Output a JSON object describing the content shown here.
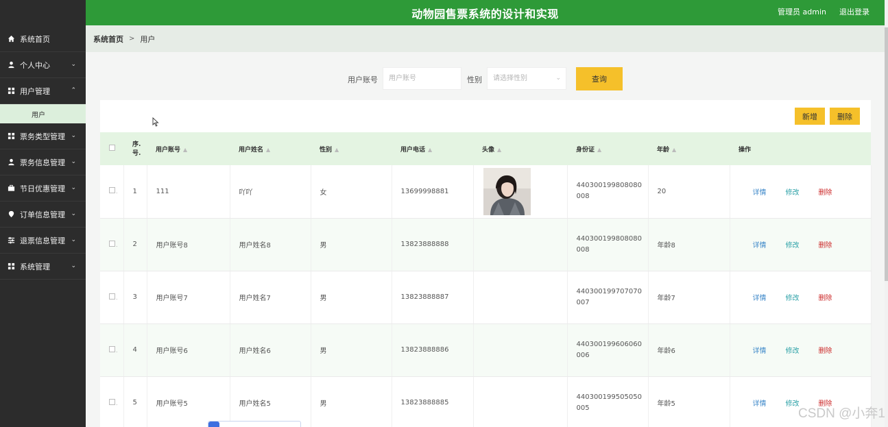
{
  "header": {
    "title": "动物园售票系统的设计和实现",
    "user_text": "管理员 admin",
    "logout_label": "退出登录"
  },
  "sidebar": {
    "items": [
      {
        "label": "系统首页",
        "icon": "home-icon",
        "has_chevron": false
      },
      {
        "label": "个人中心",
        "icon": "person-icon",
        "has_chevron": true
      },
      {
        "label": "用户管理",
        "icon": "grid-icon",
        "has_chevron": true,
        "expanded": true
      },
      {
        "label": "票务类型管理",
        "icon": "grid-icon",
        "has_chevron": true
      },
      {
        "label": "票务信息管理",
        "icon": "person-icon",
        "has_chevron": true
      },
      {
        "label": "节日优惠管理",
        "icon": "briefcase-icon",
        "has_chevron": true
      },
      {
        "label": "订单信息管理",
        "icon": "location-pin-icon",
        "has_chevron": true
      },
      {
        "label": "退票信息管理",
        "icon": "sliders-icon",
        "has_chevron": true
      },
      {
        "label": "系统管理",
        "icon": "grid-icon",
        "has_chevron": true
      }
    ],
    "subitem": "用户"
  },
  "breadcrumb": {
    "home": "系统首页",
    "separator": ">",
    "current": "用户"
  },
  "search": {
    "account_label": "用户账号",
    "account_placeholder": "用户账号",
    "gender_label": "性别",
    "gender_placeholder": "请选择性别",
    "query_label": "查询"
  },
  "toolbar": {
    "add_label": "新增",
    "delete_label": "删除"
  },
  "table": {
    "headers": {
      "index": "序号",
      "account": "用户账号",
      "name": "用户姓名",
      "gender": "性别",
      "phone": "用户电话",
      "avatar": "头像",
      "idcard": "身份证",
      "age": "年龄",
      "ops": "操作"
    },
    "ops": {
      "detail": "详情",
      "edit": "修改",
      "delete": "删除"
    },
    "rows": [
      {
        "index": "1",
        "account": "111",
        "name": "吖吖",
        "gender": "女",
        "phone": "13699998881",
        "has_avatar": true,
        "idcard": "440300199808080008",
        "age": "20"
      },
      {
        "index": "2",
        "account": "用户账号8",
        "name": "用户姓名8",
        "gender": "男",
        "phone": "13823888888",
        "has_avatar": false,
        "idcard": "440300199808080008",
        "age": "年龄8"
      },
      {
        "index": "3",
        "account": "用户账号7",
        "name": "用户姓名7",
        "gender": "男",
        "phone": "13823888887",
        "has_avatar": false,
        "idcard": "440300199707070007",
        "age": "年龄7"
      },
      {
        "index": "4",
        "account": "用户账号6",
        "name": "用户姓名6",
        "gender": "男",
        "phone": "13823888886",
        "has_avatar": false,
        "idcard": "440300199606060006",
        "age": "年龄6"
      },
      {
        "index": "5",
        "account": "用户账号5",
        "name": "用户姓名5",
        "gender": "男",
        "phone": "13823888885",
        "has_avatar": false,
        "idcard": "440300199505050005",
        "age": "年龄5"
      }
    ]
  },
  "watermark": "CSDN @小奔1",
  "colors": {
    "header_green": "#2e9a38",
    "sidebar_dark": "#2c2c2c",
    "accent_yellow": "#f5c02a",
    "table_header": "#e4f4e2"
  }
}
